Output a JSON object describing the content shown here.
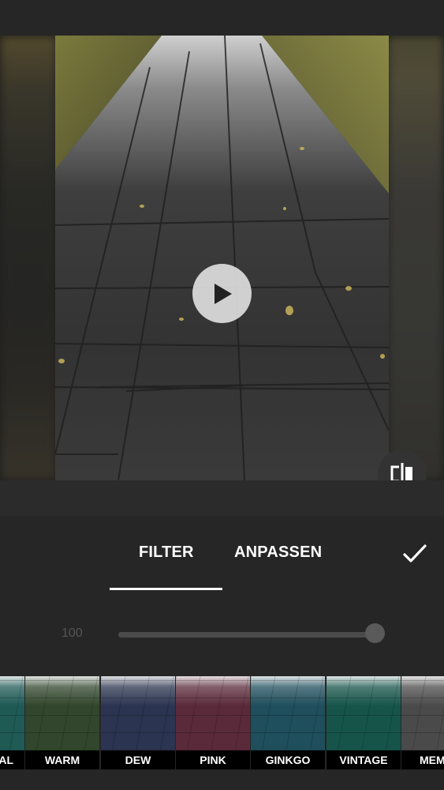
{
  "preview": {
    "play_icon": "play-icon",
    "compare_icon": "compare-split-icon"
  },
  "tabs": {
    "filter_label": "FILTER",
    "adjust_label": "ANPASSEN",
    "confirm_icon": "checkmark-icon",
    "active": "FILTER"
  },
  "intensity": {
    "value": "100",
    "level_percent": 100
  },
  "filters": [
    {
      "label": "AL",
      "tint": "#1f5a55"
    },
    {
      "label": "WARM",
      "tint": "#31462c"
    },
    {
      "label": "DEW",
      "tint": "#2b3450"
    },
    {
      "label": "PINK",
      "tint": "#5a2a3a"
    },
    {
      "label": "GINKGO",
      "tint": "#1f4e5c"
    },
    {
      "label": "VINTAGE",
      "tint": "#16544a"
    },
    {
      "label": "MEM",
      "tint": "#4a4a4a"
    }
  ],
  "colors": {
    "background": "#262626",
    "accent": "#ffffff"
  }
}
